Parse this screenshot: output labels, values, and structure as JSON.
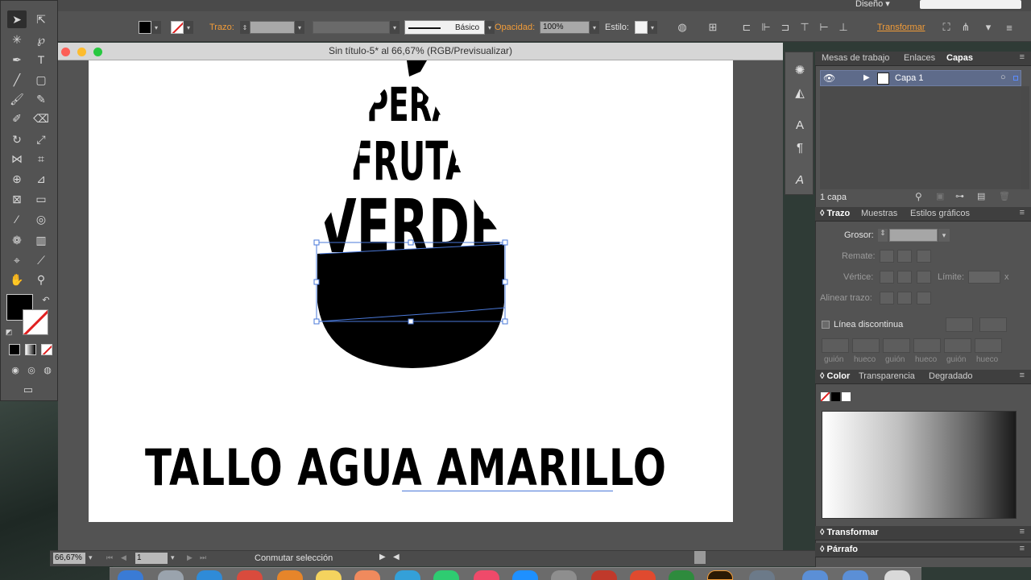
{
  "workspace": {
    "label": "Diseño ▾"
  },
  "options_bar": {
    "stroke_label": "Trazo:",
    "stroke_profile": "Básico",
    "opacity_label": "Opacidad:",
    "opacity_value": "100%",
    "style_label": "Estilo:",
    "transform_label": "Transformar"
  },
  "document": {
    "title": "Sin título-5* al 66,67% (RGB/Previsualizar)",
    "art_words": [
      "PERA",
      "FRUTA",
      "VERDE"
    ],
    "bottom_text": "TALLO AGUA AMARILLO"
  },
  "status": {
    "zoom": "66,67%",
    "page": "1",
    "text": "Conmutar selección"
  },
  "layers_panel": {
    "tabs": [
      "Mesas de trabajo",
      "Enlaces",
      "Capas"
    ],
    "layer_name": "Capa 1",
    "count": "1 capa"
  },
  "stroke_panel": {
    "tabs": [
      "Trazo",
      "Muestras",
      "Estilos gráficos"
    ],
    "weight_label": "Grosor:",
    "cap_label": "Remate:",
    "corner_label": "Vértice:",
    "limit_label": "Límite:",
    "limit_suffix": "x",
    "align_label": "Alinear trazo:",
    "dashed_label": "Línea discontinua",
    "dash_labels": [
      "guión",
      "hueco",
      "guión",
      "hueco",
      "guión",
      "hueco"
    ]
  },
  "color_panel": {
    "tabs": [
      "Color",
      "Transparencia",
      "Degradado"
    ]
  },
  "collapsed_panels": {
    "transform": "Transformar",
    "paragraph": "Párrafo"
  },
  "colors": {
    "accent_orange": "#f29c38",
    "selection_blue": "#4a78d8",
    "fill": "#000000"
  }
}
